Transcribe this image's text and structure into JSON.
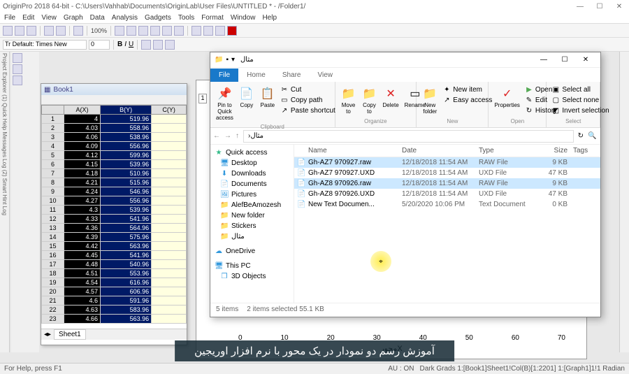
{
  "origin": {
    "title": "OriginPro 2018 64-bit - C:\\Users\\Vahhab\\Documents\\OriginLab\\User Files\\UNTITLED * - /Folder1/",
    "menus": [
      "File",
      "Edit",
      "View",
      "Graph",
      "Data",
      "Analysis",
      "Gadgets",
      "Tools",
      "Format",
      "Window",
      "Help"
    ],
    "zoom": "100%",
    "font_default": "Tr Default: Times New",
    "font_size": "0",
    "status_left": "For Help, press F1",
    "status_right_1": "AU : ON",
    "status_right_2": "Dark Grads  1:[Book1]Sheet1!Col(B)[1:2201]  1:[Graph1]1!1  Radian",
    "book": {
      "title": "Book1",
      "sheet": "Sheet1",
      "headers": [
        "",
        "A(X)",
        "B(Y)",
        "C(Y)"
      ],
      "rows": [
        [
          "1",
          "4",
          "519.96",
          ""
        ],
        [
          "2",
          "4.03",
          "558.96",
          ""
        ],
        [
          "3",
          "4.06",
          "538.96",
          ""
        ],
        [
          "4",
          "4.09",
          "556.96",
          ""
        ],
        [
          "5",
          "4.12",
          "599.96",
          ""
        ],
        [
          "6",
          "4.15",
          "539.96",
          ""
        ],
        [
          "7",
          "4.18",
          "510.96",
          ""
        ],
        [
          "8",
          "4.21",
          "515.96",
          ""
        ],
        [
          "9",
          "4.24",
          "546.96",
          ""
        ],
        [
          "10",
          "4.27",
          "556.96",
          ""
        ],
        [
          "11",
          "4.3",
          "539.96",
          ""
        ],
        [
          "12",
          "4.33",
          "541.96",
          ""
        ],
        [
          "13",
          "4.36",
          "564.96",
          ""
        ],
        [
          "14",
          "4.39",
          "575.96",
          ""
        ],
        [
          "15",
          "4.42",
          "563.96",
          ""
        ],
        [
          "16",
          "4.45",
          "541.96",
          ""
        ],
        [
          "17",
          "4.48",
          "540.96",
          ""
        ],
        [
          "18",
          "4.51",
          "553.96",
          ""
        ],
        [
          "19",
          "4.54",
          "616.96",
          ""
        ],
        [
          "20",
          "4.57",
          "606.96",
          ""
        ],
        [
          "21",
          "4.6",
          "591.96",
          ""
        ],
        [
          "22",
          "4.63",
          "583.96",
          ""
        ],
        [
          "23",
          "4.66",
          "563.96",
          ""
        ]
      ]
    },
    "graph": {
      "tab": "1",
      "x_ticks": [
        "0",
        "10",
        "20",
        "30",
        "40",
        "50",
        "60",
        "70"
      ],
      "x_label": "محورX"
    }
  },
  "explorer": {
    "title": "مثال",
    "tabs": {
      "file": "File",
      "home": "Home",
      "share": "Share",
      "view": "View"
    },
    "ribbon": {
      "clipboard": {
        "label": "Clipboard",
        "pin": "Pin to Quick access",
        "copy": "Copy",
        "paste": "Paste",
        "cut": "Cut",
        "copy_path": "Copy path",
        "paste_shortcut": "Paste shortcut"
      },
      "organize": {
        "label": "Organize",
        "move": "Move to",
        "copy": "Copy to",
        "delete": "Delete",
        "rename": "Rename"
      },
      "new": {
        "label": "New",
        "folder": "New folder",
        "item": "New item",
        "easy": "Easy access"
      },
      "open": {
        "label": "Open",
        "props": "Properties",
        "open": "Open",
        "edit": "Edit",
        "history": "History"
      },
      "select": {
        "label": "Select",
        "all": "Select all",
        "none": "Select none",
        "invert": "Invert selection"
      }
    },
    "path": "مثال",
    "columns": {
      "name": "Name",
      "date": "Date",
      "type": "Type",
      "size": "Size",
      "tags": "Tags"
    },
    "nav": {
      "quick": "Quick access",
      "desktop": "Desktop",
      "downloads": "Downloads",
      "documents": "Documents",
      "pictures": "Pictures",
      "alef": "AlefBeAmozesh",
      "newf": "New folder",
      "stickers": "Stickers",
      "mesal": "مثال",
      "onedrive": "OneDrive",
      "thispc": "This PC",
      "objects3d": "3D Objects"
    },
    "files": [
      {
        "name": "Gh-AZ7 970927.raw",
        "date": "12/18/2018 11:54 AM",
        "type": "RAW File",
        "size": "9 KB",
        "sel": true
      },
      {
        "name": "Gh-AZ7 970927.UXD",
        "date": "12/18/2018 11:54 AM",
        "type": "UXD File",
        "size": "47 KB",
        "sel": false
      },
      {
        "name": "Gh-AZ8 970926.raw",
        "date": "12/18/2018 11:54 AM",
        "type": "RAW File",
        "size": "9 KB",
        "sel": true
      },
      {
        "name": "Gh-AZ8 970926.UXD",
        "date": "12/18/2018 11:54 AM",
        "type": "UXD File",
        "size": "47 KB",
        "sel": false
      },
      {
        "name": "New Text Documen...",
        "date": "5/20/2020 10:06 PM",
        "type": "Text Document",
        "size": "0 KB",
        "sel": false
      }
    ],
    "status": {
      "items": "5 items",
      "selected": "2 items selected  55.1 KB"
    }
  },
  "caption": "آموزش رسم دو نمودار در یک محور با نرم افزار اوریجین"
}
